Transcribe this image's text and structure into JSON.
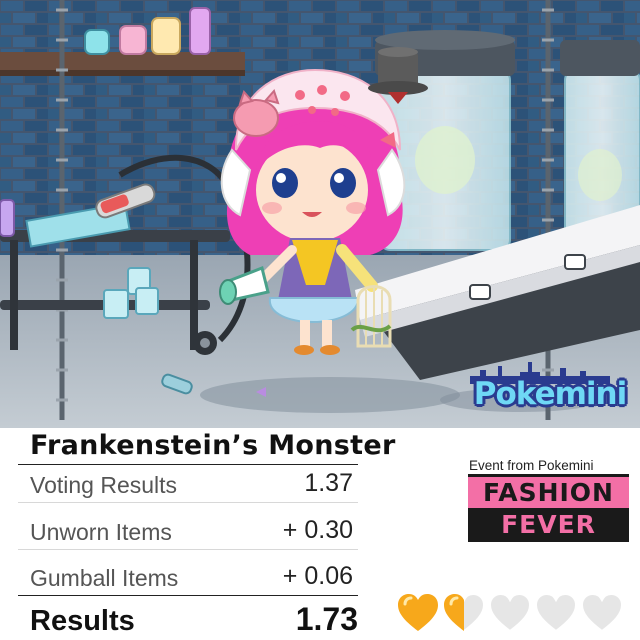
{
  "scene": {
    "logo_text": "Pokemini"
  },
  "results": {
    "title": "Frankenstein’s Monster",
    "rows": [
      {
        "label": "Voting Results",
        "value": "1.37"
      },
      {
        "label": "Unworn Items",
        "value": "+ 0.30"
      },
      {
        "label": "Gumball Items",
        "value": "+ 0.06"
      }
    ],
    "total_label": "Results",
    "total_value": "1.73"
  },
  "event": {
    "caption": "Event from Pokemini",
    "line1": "FASHION",
    "line2": "FEVER"
  },
  "rating": {
    "filled": 1.5,
    "max": 5,
    "fill_color": "#f7a81b",
    "empty_color": "#e6e6e6"
  },
  "colors": {
    "event_pink": "#f36fa6",
    "logo_blue": "#6fd8f5"
  }
}
